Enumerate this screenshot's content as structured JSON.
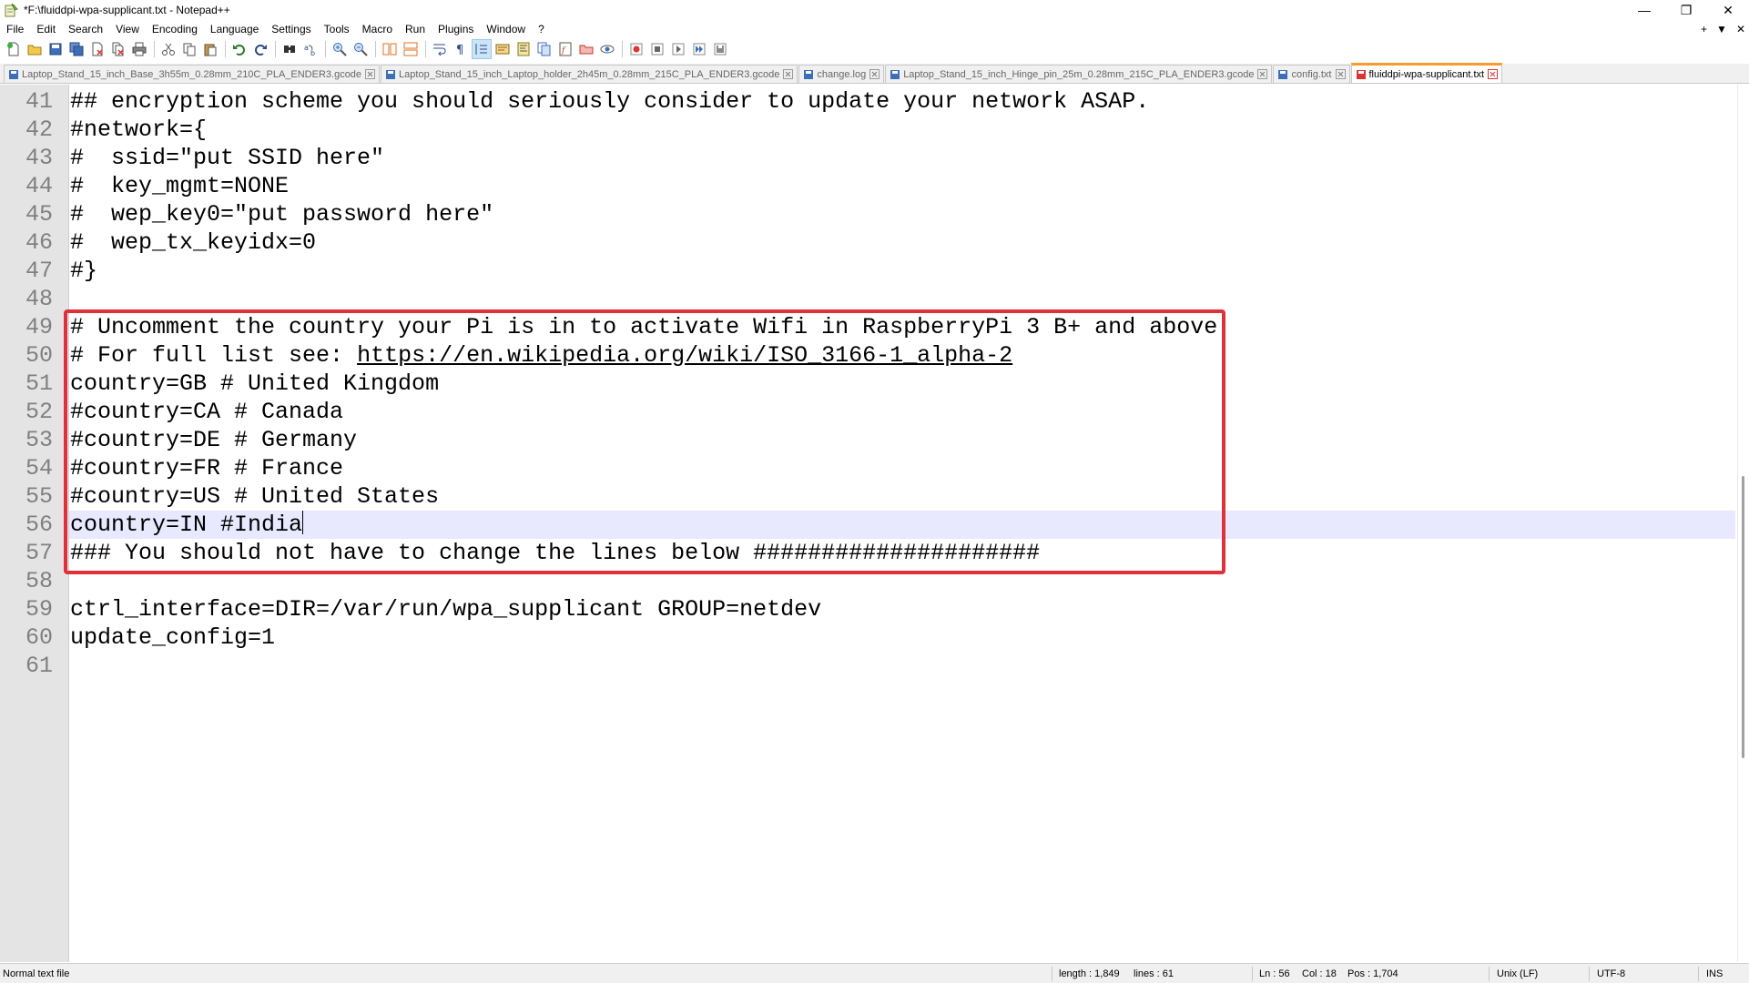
{
  "window": {
    "title": "*F:\\fluiddpi-wpa-supplicant.txt - Notepad++",
    "minimize": "—",
    "maximize": "❐",
    "close": "✕"
  },
  "menu": {
    "items": [
      "File",
      "Edit",
      "Search",
      "View",
      "Encoding",
      "Language",
      "Settings",
      "Tools",
      "Macro",
      "Run",
      "Plugins",
      "Window",
      "?"
    ],
    "right_plus": "+",
    "right_down": "▼",
    "right_close": "✕"
  },
  "tabs": [
    {
      "label": "Laptop_Stand_15_inch_Base_3h55m_0.28mm_210C_PLA_ENDER3.gcode",
      "active": false
    },
    {
      "label": "Laptop_Stand_15_inch_Laptop_holder_2h45m_0.28mm_215C_PLA_ENDER3.gcode",
      "active": false
    },
    {
      "label": "change.log",
      "active": false
    },
    {
      "label": "Laptop_Stand_15_inch_Hinge_pin_25m_0.28mm_215C_PLA_ENDER3.gcode",
      "active": false
    },
    {
      "label": "config.txt",
      "active": false
    },
    {
      "label": "fluiddpi-wpa-supplicant.txt",
      "active": true
    }
  ],
  "editor": {
    "lines": [
      {
        "no": "41",
        "text": "## encryption scheme you should seriously consider to update your network ASAP."
      },
      {
        "no": "42",
        "text": "#network={"
      },
      {
        "no": "43",
        "text": "#  ssid=\"put SSID here\""
      },
      {
        "no": "44",
        "text": "#  key_mgmt=NONE"
      },
      {
        "no": "45",
        "text": "#  wep_key0=\"put password here\""
      },
      {
        "no": "46",
        "text": "#  wep_tx_keyidx=0"
      },
      {
        "no": "47",
        "text": "#}"
      },
      {
        "no": "48",
        "text": ""
      },
      {
        "no": "49",
        "text": "# Uncomment the country your Pi is in to activate Wifi in RaspberryPi 3 B+ and above"
      },
      {
        "no": "50",
        "text": "# For full list see: ",
        "url": "https://en.wikipedia.org/wiki/ISO_3166-1_alpha-2"
      },
      {
        "no": "51",
        "text": "country=GB # United Kingdom"
      },
      {
        "no": "52",
        "text": "#country=CA # Canada"
      },
      {
        "no": "53",
        "text": "#country=DE # Germany"
      },
      {
        "no": "54",
        "text": "#country=FR # France"
      },
      {
        "no": "55",
        "text": "#country=US # United States"
      },
      {
        "no": "56",
        "text": "country=IN #India",
        "current": true
      },
      {
        "no": "57",
        "text": "### You should not have to change the lines below #####################"
      },
      {
        "no": "58",
        "text": ""
      },
      {
        "no": "59",
        "text": "ctrl_interface=DIR=/var/run/wpa_supplicant GROUP=netdev"
      },
      {
        "no": "60",
        "text": "update_config=1"
      },
      {
        "no": "61",
        "text": ""
      }
    ]
  },
  "status": {
    "file_type": "Normal text file",
    "length": "length : 1,849",
    "lines": "lines : 61",
    "ln": "Ln : 56",
    "col": "Col : 18",
    "pos": "Pos : 1,704",
    "eol": "Unix (LF)",
    "encoding": "UTF-8",
    "mode": "INS"
  },
  "colors": {
    "highlight_box": "#e0303a",
    "active_tab_accent": "#fa9b2c",
    "current_line": "#e8e8ff"
  }
}
